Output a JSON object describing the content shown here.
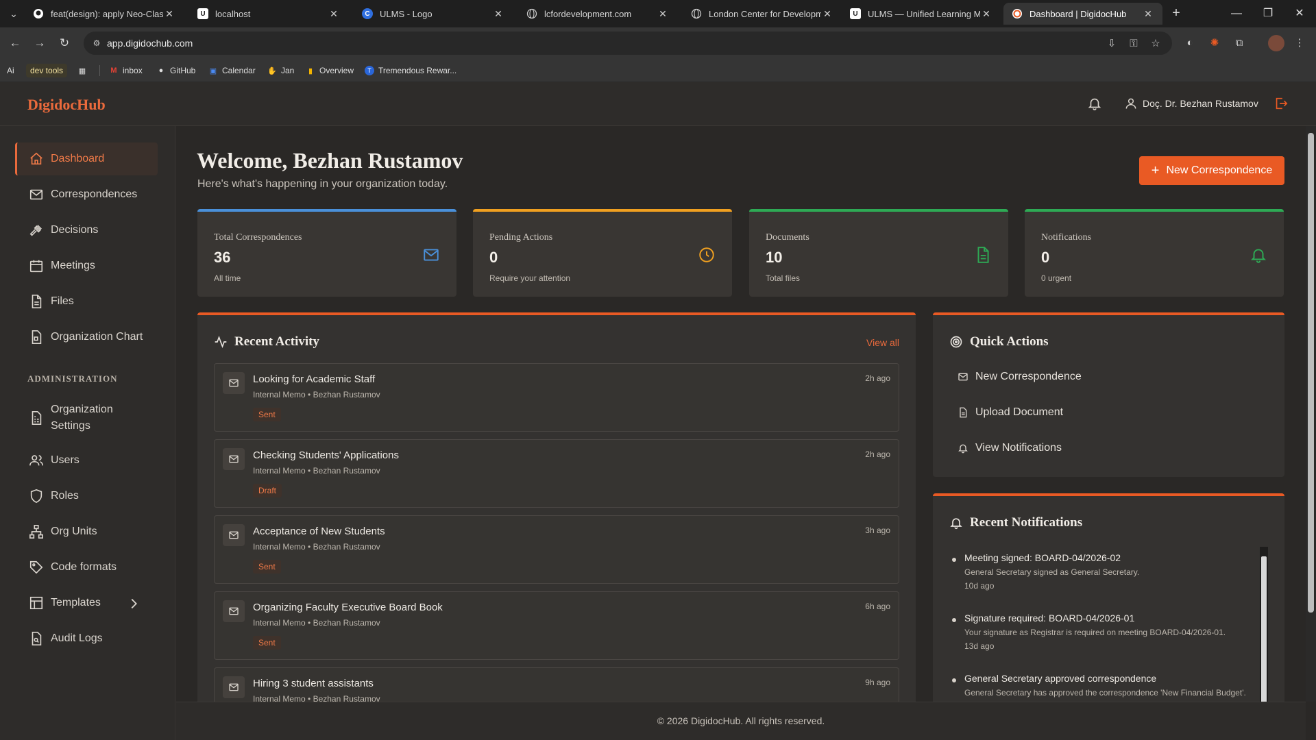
{
  "browser": {
    "tabs": [
      {
        "title": "feat(design): apply Neo-Classic",
        "favicon": "github-icon"
      },
      {
        "title": "localhost",
        "favicon": "u-icon"
      },
      {
        "title": "ULMS - Logo",
        "favicon": "c-icon"
      },
      {
        "title": "lcfordevelopment.com",
        "favicon": "globe-icon"
      },
      {
        "title": "London Center for Developmen",
        "favicon": "globe-icon"
      },
      {
        "title": "ULMS — Unified Learning Man",
        "favicon": "u-icon"
      },
      {
        "title": "Dashboard | DigidocHub",
        "favicon": "digidoc-icon",
        "active": true
      }
    ],
    "url": "app.digidochub.com",
    "bookmarks": [
      {
        "label": "Ai"
      },
      {
        "label": "dev tools"
      },
      {
        "label": "inbox"
      },
      {
        "label": "GitHub"
      },
      {
        "label": "Calendar"
      },
      {
        "label": "Jan"
      },
      {
        "label": "Overview"
      },
      {
        "label": "Tremendous Rewar..."
      }
    ]
  },
  "header": {
    "brand": "DigidocHub",
    "user_name": "Doç. Dr. Bezhan Rustamov"
  },
  "sidebar": {
    "items": [
      {
        "label": "Dashboard",
        "icon": "home-icon",
        "active": true
      },
      {
        "label": "Correspondences",
        "icon": "mail-icon"
      },
      {
        "label": "Decisions",
        "icon": "gavel-icon"
      },
      {
        "label": "Meetings",
        "icon": "calendar-icon"
      },
      {
        "label": "Files",
        "icon": "file-icon"
      },
      {
        "label": "Organization Chart",
        "icon": "org-chart-icon"
      }
    ],
    "admin_heading": "ADMINISTRATION",
    "admin_items": [
      {
        "label": "Organization Settings",
        "line1": "Organization",
        "line2": "Settings",
        "icon": "building-icon"
      },
      {
        "label": "Users",
        "icon": "users-icon"
      },
      {
        "label": "Roles",
        "icon": "shield-icon"
      },
      {
        "label": "Org Units",
        "icon": "sitemap-icon"
      },
      {
        "label": "Code formats",
        "icon": "tag-icon"
      },
      {
        "label": "Templates",
        "icon": "layout-icon"
      },
      {
        "label": "Audit Logs",
        "icon": "file-search-icon"
      }
    ]
  },
  "main": {
    "welcome": "Welcome, Bezhan Rustamov",
    "subtitle": "Here's what's happening in your organization today.",
    "new_button": "New Correspondence",
    "stats": [
      {
        "label": "Total Correspondences",
        "value": "36",
        "sub": "All time",
        "color": "#4a90d9",
        "icon": "mail-icon"
      },
      {
        "label": "Pending Actions",
        "value": "0",
        "sub": "Require your attention",
        "color": "#f0a020",
        "icon": "clock-icon"
      },
      {
        "label": "Documents",
        "value": "10",
        "sub": "Total files",
        "color": "#2eaa55",
        "icon": "document-icon"
      },
      {
        "label": "Notifications",
        "value": "0",
        "sub": "0 urgent",
        "color": "#2eaa55",
        "icon": "bell-icon"
      }
    ],
    "recent_activity": {
      "title": "Recent Activity",
      "view_all": "View all",
      "items": [
        {
          "title": "Looking for Academic Staff",
          "meta": "Internal Memo • Bezhan Rustamov",
          "status": "Sent",
          "time": "2h ago"
        },
        {
          "title": "Checking Students' Applications",
          "meta": "Internal Memo • Bezhan Rustamov",
          "status": "Draft",
          "time": "2h ago"
        },
        {
          "title": "Acceptance of New Students",
          "meta": "Internal Memo • Bezhan Rustamov",
          "status": "Sent",
          "time": "3h ago"
        },
        {
          "title": "Organizing Faculty Executive Board Book",
          "meta": "Internal Memo • Bezhan Rustamov",
          "status": "Sent",
          "time": "6h ago"
        },
        {
          "title": "Hiring 3 student assistants",
          "meta": "Internal Memo • Bezhan Rustamov",
          "status": "",
          "time": "9h ago"
        }
      ]
    },
    "quick_actions": {
      "title": "Quick Actions",
      "items": [
        {
          "label": "New Correspondence",
          "icon": "mail-icon"
        },
        {
          "label": "Upload Document",
          "icon": "document-icon"
        },
        {
          "label": "View Notifications",
          "icon": "bell-icon"
        }
      ]
    },
    "recent_notifications": {
      "title": "Recent Notifications",
      "items": [
        {
          "title": "Meeting signed: BOARD-04/2026-02",
          "desc": "General Secretary signed as General Secretary.",
          "time": "10d ago"
        },
        {
          "title": "Signature required: BOARD-04/2026-01",
          "desc": "Your signature as Registrar is required on meeting BOARD-04/2026-01.",
          "time": "13d ago"
        },
        {
          "title": "General Secretary approved correspondence",
          "desc": "General Secretary has approved the correspondence 'New Financial Budget'.",
          "time": ""
        }
      ]
    }
  },
  "footer": {
    "text": "© 2026 DigidocHub. All rights reserved."
  }
}
